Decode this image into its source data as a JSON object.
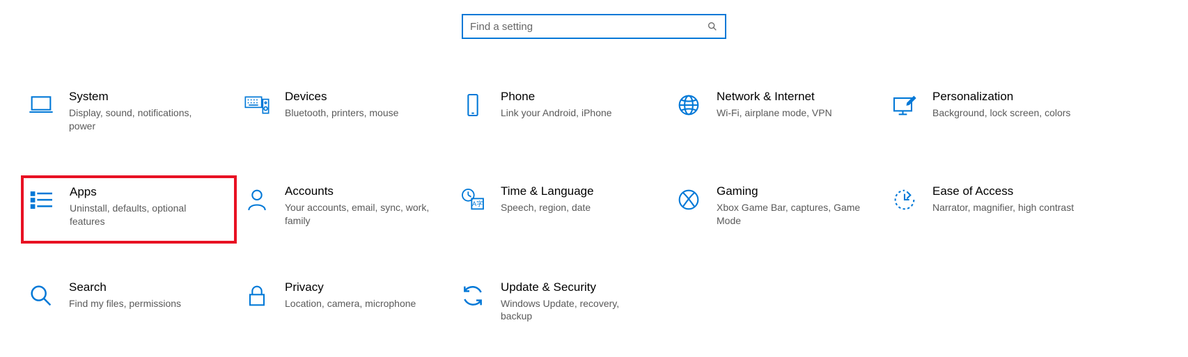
{
  "search": {
    "placeholder": "Find a setting"
  },
  "tiles": [
    {
      "id": "system",
      "title": "System",
      "desc": "Display, sound, notifications, power",
      "highlighted": false
    },
    {
      "id": "devices",
      "title": "Devices",
      "desc": "Bluetooth, printers, mouse",
      "highlighted": false
    },
    {
      "id": "phone",
      "title": "Phone",
      "desc": "Link your Android, iPhone",
      "highlighted": false
    },
    {
      "id": "network",
      "title": "Network & Internet",
      "desc": "Wi-Fi, airplane mode, VPN",
      "highlighted": false
    },
    {
      "id": "personalization",
      "title": "Personalization",
      "desc": "Background, lock screen, colors",
      "highlighted": false
    },
    {
      "id": "apps",
      "title": "Apps",
      "desc": "Uninstall, defaults, optional features",
      "highlighted": true
    },
    {
      "id": "accounts",
      "title": "Accounts",
      "desc": "Your accounts, email, sync, work, family",
      "highlighted": false
    },
    {
      "id": "time",
      "title": "Time & Language",
      "desc": "Speech, region, date",
      "highlighted": false
    },
    {
      "id": "gaming",
      "title": "Gaming",
      "desc": "Xbox Game Bar, captures, Game Mode",
      "highlighted": false
    },
    {
      "id": "ease",
      "title": "Ease of Access",
      "desc": "Narrator, magnifier, high contrast",
      "highlighted": false
    },
    {
      "id": "search",
      "title": "Search",
      "desc": "Find my files, permissions",
      "highlighted": false
    },
    {
      "id": "privacy",
      "title": "Privacy",
      "desc": "Location, camera, microphone",
      "highlighted": false
    },
    {
      "id": "update",
      "title": "Update & Security",
      "desc": "Windows Update, recovery, backup",
      "highlighted": false
    }
  ],
  "icons": {
    "system": "laptop-icon",
    "devices": "keyboard-speaker-icon",
    "phone": "phone-icon",
    "network": "globe-icon",
    "personalization": "pen-monitor-icon",
    "apps": "apps-list-icon",
    "accounts": "person-icon",
    "time": "time-language-icon",
    "gaming": "xbox-icon",
    "ease": "ease-of-access-icon",
    "search": "magnifier-icon",
    "privacy": "lock-icon",
    "update": "sync-icon"
  }
}
